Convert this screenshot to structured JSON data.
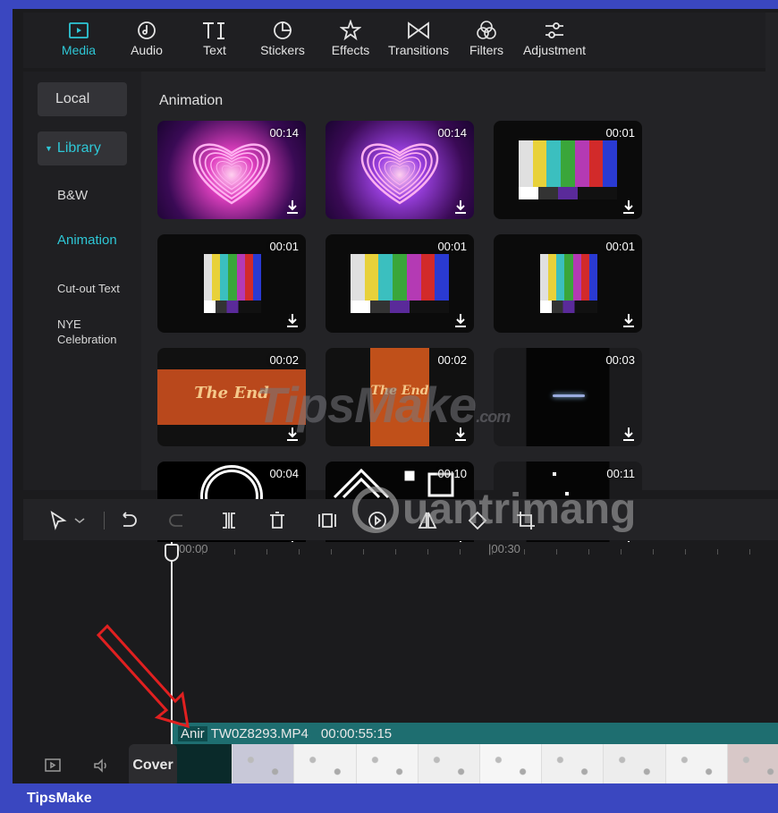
{
  "toolbar": {
    "tabs": [
      {
        "label": "Media",
        "icon": "media-icon",
        "active": true
      },
      {
        "label": "Audio",
        "icon": "audio-icon",
        "active": false
      },
      {
        "label": "Text",
        "icon": "text-icon",
        "active": false
      },
      {
        "label": "Stickers",
        "icon": "sticker-icon",
        "active": false
      },
      {
        "label": "Effects",
        "icon": "effects-icon",
        "active": false
      },
      {
        "label": "Transitions",
        "icon": "transitions-icon",
        "active": false
      },
      {
        "label": "Filters",
        "icon": "filters-icon",
        "active": false
      },
      {
        "label": "Adjustment",
        "icon": "adjustment-icon",
        "active": false
      }
    ]
  },
  "sidebar": {
    "local": "Local",
    "library": "Library",
    "items": [
      "B&W",
      "Animation",
      "Cut-out Text",
      "NYE Celebration"
    ],
    "active_item": "Animation"
  },
  "main": {
    "section_title": "Animation",
    "thumbs": [
      {
        "duration": "00:14",
        "kind": "heart-pink"
      },
      {
        "duration": "00:14",
        "kind": "heart-purple"
      },
      {
        "duration": "00:01",
        "kind": "color-bars"
      },
      {
        "duration": "00:01",
        "kind": "color-bars-tall"
      },
      {
        "duration": "00:01",
        "kind": "color-bars"
      },
      {
        "duration": "00:01",
        "kind": "color-bars-tall"
      },
      {
        "duration": "00:02",
        "kind": "the-end"
      },
      {
        "duration": "00:02",
        "kind": "the-end-small"
      },
      {
        "duration": "00:03",
        "kind": "dark-line"
      },
      {
        "duration": "00:04",
        "kind": "white-ring"
      },
      {
        "duration": "00:10",
        "kind": "white-shapes"
      },
      {
        "duration": "00:11",
        "kind": "dark-dots"
      }
    ]
  },
  "timeline": {
    "ruler": [
      "00:00",
      "|00:30"
    ],
    "clip": {
      "prefix": "Anir",
      "name": "TW0Z8293.MP4",
      "duration": "00:00:55:15"
    },
    "cover_label": "Cover"
  },
  "watermarks": {
    "tipsmake": "TipsMake",
    "tipsmake_suffix": ".com",
    "quantrimang": "uantrimang"
  },
  "footer": {
    "brand": "TipsMake"
  },
  "colors": {
    "accent": "#2ec7d6",
    "clip": "#1e6e70",
    "frame_border": "#3a47c0"
  }
}
